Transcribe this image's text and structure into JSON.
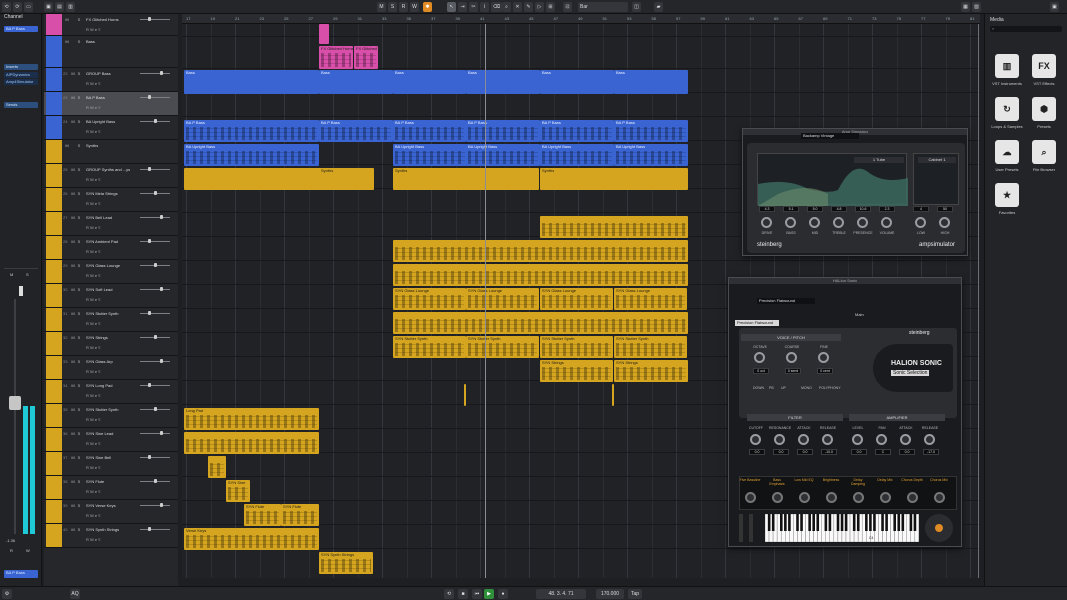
{
  "toolbar": {
    "left_icons": [
      "undo-icon",
      "redo-icon",
      "panel-icon"
    ],
    "buttons": [
      "M",
      "S",
      "R",
      "W"
    ],
    "grid_label": "Bar",
    "center_labels": [
      "M",
      "S",
      "R",
      "W"
    ]
  },
  "inspector": {
    "title": "Channel",
    "track": "BA P Bass",
    "sections": [
      "Inserts",
      "Sends"
    ],
    "inserts": [
      "AIPDynamics",
      "Amp4Simulator"
    ],
    "bottom_track": "BA P Bass",
    "meter_labels": [
      "M",
      "S",
      "R",
      "W"
    ],
    "value_readout": "-1.36"
  },
  "ruler": {
    "bars": [
      "17",
      "19",
      "21",
      "23",
      "25",
      "27",
      "29",
      "31",
      "33",
      "35",
      "37",
      "39",
      "41",
      "43",
      "45",
      "47",
      "49",
      "51",
      "53",
      "55",
      "57",
      "59",
      "61",
      "63",
      "65",
      "67",
      "69",
      "71",
      "73",
      "75",
      "77",
      "79",
      "81",
      "83"
    ]
  },
  "tracks": [
    {
      "num": "",
      "name": "FX Glitched Horns",
      "color": "#d84fa9"
    },
    {
      "num": "",
      "name": "Bass",
      "color": "#3a64d1",
      "folder": true
    },
    {
      "num": "22",
      "name": "GROUP Bass",
      "color": "#3a64d1"
    },
    {
      "num": "23",
      "name": "BA P Bass",
      "color": "#3a64d1",
      "selected": true
    },
    {
      "num": "24",
      "name": "BA Upright Bass",
      "color": "#3a64d1"
    },
    {
      "num": "",
      "name": "Synths",
      "color": "#d6a51f",
      "folder": true
    },
    {
      "num": "25",
      "name": "GROUP Synths and ...ys",
      "color": "#d6a51f"
    },
    {
      "num": "26",
      "name": "SYN Mela Strings",
      "color": "#d6a51f"
    },
    {
      "num": "27",
      "name": "SYN Bell Lead",
      "color": "#d6a51f"
    },
    {
      "num": "28",
      "name": "SYN Ambient Pad",
      "color": "#d6a51f"
    },
    {
      "num": "29",
      "name": "SYN Glass Lounge",
      "color": "#d6a51f"
    },
    {
      "num": "30",
      "name": "SYN Soft Lead",
      "color": "#d6a51f"
    },
    {
      "num": "31",
      "name": "SYN Stutter Synth",
      "color": "#d6a51f"
    },
    {
      "num": "32",
      "name": "SYN Strings",
      "color": "#d6a51f"
    },
    {
      "num": "33",
      "name": "SYN Glass Arp",
      "color": "#d6a51f"
    },
    {
      "num": "34",
      "name": "SYN Long Pad",
      "color": "#d6a51f"
    },
    {
      "num": "35",
      "name": "SYN Stutter Synth",
      "color": "#d6a51f"
    },
    {
      "num": "36",
      "name": "SYN Sine Lead",
      "color": "#d6a51f"
    },
    {
      "num": "37",
      "name": "SYN Sine Bell",
      "color": "#d6a51f"
    },
    {
      "num": "38",
      "name": "SYN Flute",
      "color": "#d6a51f"
    },
    {
      "num": "39",
      "name": "SYN Verse Keys",
      "color": "#d6a51f"
    },
    {
      "num": "40",
      "name": "SYN Synth Strings",
      "color": "#d6a51f"
    }
  ],
  "events": {
    "horns": [
      "FX Glitched Horns",
      "FX Glitched"
    ],
    "bass": [
      "Bass",
      "Bass",
      "Bass",
      "Bass",
      "Bass",
      "Bass"
    ],
    "pbass": [
      "BA P Bass",
      "BA P Bass",
      "BA P Bass",
      "BA P Bass",
      "BA P Bass",
      "BA P Bass"
    ],
    "upright": [
      "BA Upright Bass",
      "BA Upright Bass",
      "BA Upright Bass",
      "BA Upright Bass",
      "BA Upright Bass",
      "BA Upright Bass"
    ],
    "synths": [
      "Synths",
      "Synths",
      "Synths"
    ],
    "glass": [
      "SYN Glass Lounge",
      "SYN Glass Lounge",
      "SYN Glass Lounge",
      "SYN Glass Lounge"
    ],
    "stutter": [
      "SYN Stutter Synth",
      "SYN Stutter Synth",
      "SYN Stutter Synth",
      "SYN Stutter Synth"
    ],
    "strings": [
      "SYN Strings",
      "SYN Strings"
    ],
    "longpad": "Long Pad",
    "sinebell": "SYN Sine",
    "flute": [
      "SYN Flute",
      "SYN Flute"
    ],
    "versekeys": "Verse Keys",
    "synthstrings": "SYN Synth Strings"
  },
  "ampsim": {
    "title": "Amp Simulator",
    "preset": "Backamp Vintage",
    "amp": "1 Tube",
    "cabinet": "Cabinet 1",
    "knobs": [
      {
        "label": "DRIVE",
        "value": "4.3"
      },
      {
        "label": "BASS",
        "value": "5.1"
      },
      {
        "label": "MID",
        "value": "5.0"
      },
      {
        "label": "TREBLE",
        "value": "4.8"
      },
      {
        "label": "PRESENCE",
        "value": "10.6"
      },
      {
        "label": "VOLUME",
        "value": "2.3"
      },
      {
        "label": "LOW",
        "value": "4"
      },
      {
        "label": "HIGH",
        "value": "50"
      }
    ],
    "brand": "steinberg",
    "product": "ampsimulator"
  },
  "halion": {
    "title": "HALion Sonic",
    "preset": "Precision Flatwound",
    "program": "Precision Flatwound",
    "main": "Main",
    "voice_section": "VOICE / PITCH",
    "voice_knobs": [
      {
        "label": "OCTAVE",
        "value": "0 oct"
      },
      {
        "label": "COARSE",
        "value": "0 semi"
      },
      {
        "label": "FINE",
        "value": "0 cent"
      }
    ],
    "bend_labels": [
      "DOWN",
      "PB",
      "UP",
      "MONO",
      "POLYPHONY"
    ],
    "logo": "HALION SONIC",
    "sub": "Sonic Selection",
    "filter_title": "FILTER",
    "amp_title": "AMPLIFIER",
    "filter_knobs": [
      {
        "label": "CUTOFF",
        "value": "0.0"
      },
      {
        "label": "RESONANCE",
        "value": "0.0"
      },
      {
        "label": "ATTACK",
        "value": "0.0"
      },
      {
        "label": "RELEASE",
        "value": "-10.0"
      }
    ],
    "amp_knobs": [
      {
        "label": "LEVEL",
        "value": "0.0"
      },
      {
        "label": "PAN",
        "value": "C"
      },
      {
        "label": "ATTACK",
        "value": "0.0"
      },
      {
        "label": "RELEASE",
        "value": "-17.0"
      }
    ],
    "quick": [
      "Five Bassline",
      "Bass Emphasis",
      "Low Mid EQ",
      "Brightness",
      "Delay Damping",
      "Delay Mix",
      "Chorus Depth",
      "Chorus Mix"
    ],
    "brand": "steinberg",
    "key": "C4"
  },
  "media": {
    "title": "Media",
    "items": [
      "VST Instruments",
      "VST Effects",
      "Loops & Samples",
      "Presets",
      "User Presets",
      "File Browser",
      "Favorites"
    ]
  },
  "transport": {
    "position": "48. 3. 4. 71",
    "tempo": "170.000",
    "sig": "Tap"
  },
  "colors": {
    "accent": "#e08a24",
    "bass": "#3a64d1",
    "synth": "#d6a51f",
    "fx": "#d84fa9"
  }
}
